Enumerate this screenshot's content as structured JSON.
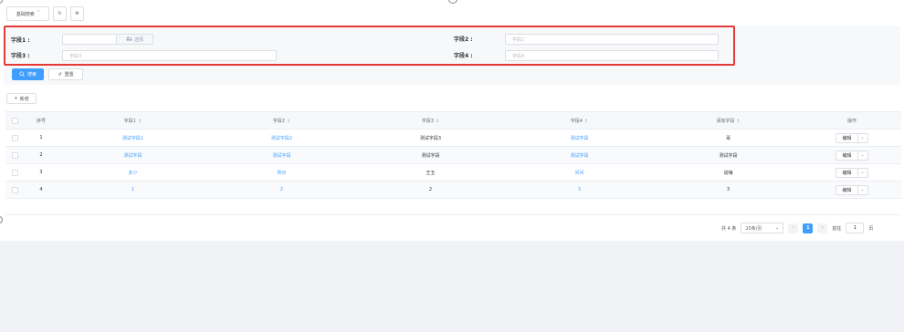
{
  "toolbar": {
    "basic_search_label": "基础搜索",
    "basic_search_chevron": "ˇ",
    "refresh_icon": "↻",
    "settings_icon": "⚙"
  },
  "search": {
    "field1_label": "字段1 :",
    "field1_value": "",
    "select_label": "选择",
    "field2_label": "字段2 :",
    "field2_placeholder": "字段2",
    "field3_label": "字段3 :",
    "field3_placeholder": "字段3",
    "field4_label": "字段4 :",
    "field4_placeholder": "字段4",
    "search_button": "搜索",
    "reset_button": "重置"
  },
  "actions": {
    "add_button": "新增"
  },
  "table": {
    "headers": [
      "序号",
      "字段1",
      "字段2",
      "字段3",
      "字段4",
      "添加字段",
      "操作"
    ],
    "sort_icon": "⇕",
    "rows": [
      {
        "index": "1",
        "f1": "测试字段1",
        "f2": "测试字段2",
        "f3": "测试字段3",
        "f4": "测试字段",
        "extra": "哥",
        "op": "编辑"
      },
      {
        "index": "2",
        "f1": "测试字段",
        "f2": "测试字段",
        "f3": "测试字段",
        "f4": "测试字段",
        "extra": "测试字段",
        "op": "编辑"
      },
      {
        "index": "3",
        "f1": "多少",
        "f2": "所示",
        "f3": "王五",
        "f4": "问问",
        "extra": "说嗨",
        "op": "编辑"
      },
      {
        "index": "4",
        "f1": "1",
        "f2": "2",
        "f3": "2",
        "f4": "3",
        "extra": "3",
        "op": "编辑"
      }
    ]
  },
  "pagination": {
    "total": "共 4 条",
    "page_size": "20条/页",
    "prev": "<",
    "current": "1",
    "next": ">",
    "goto_label": "前往",
    "goto_value": "1",
    "page_suffix": "页"
  },
  "colors": {
    "primary": "#409eff",
    "highlight": "#e53935"
  }
}
